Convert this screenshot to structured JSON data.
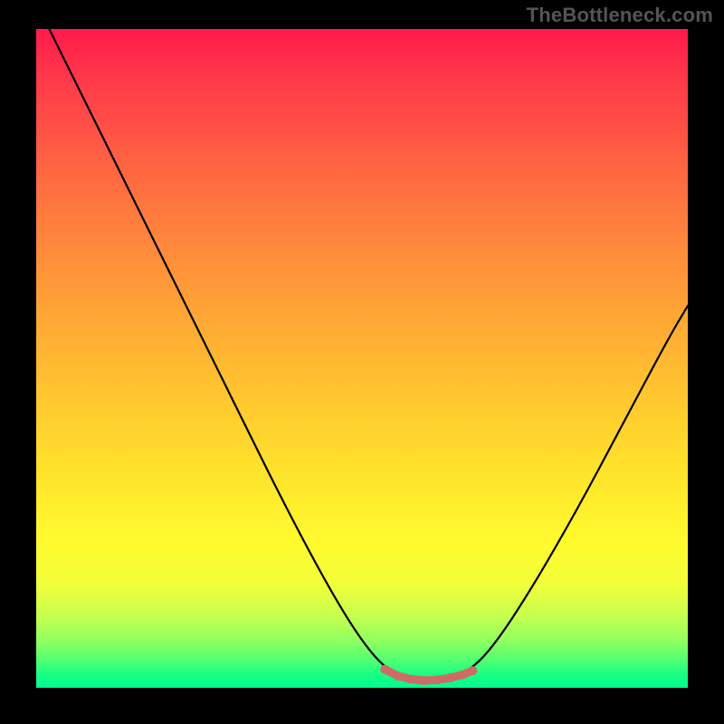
{
  "watermark": "TheBottleneck.com",
  "chart_data": {
    "type": "line",
    "title": "",
    "xlabel": "",
    "ylabel": "",
    "x_range": [
      0,
      100
    ],
    "y_range": [
      0,
      100
    ],
    "grid": false,
    "curve": [
      {
        "x": 2,
        "y": 100
      },
      {
        "x": 8,
        "y": 88
      },
      {
        "x": 15,
        "y": 74
      },
      {
        "x": 22,
        "y": 60
      },
      {
        "x": 30,
        "y": 44
      },
      {
        "x": 38,
        "y": 28
      },
      {
        "x": 45,
        "y": 15
      },
      {
        "x": 50,
        "y": 7
      },
      {
        "x": 54,
        "y": 2.5
      },
      {
        "x": 58,
        "y": 1.2
      },
      {
        "x": 62,
        "y": 1.2
      },
      {
        "x": 66,
        "y": 2.2
      },
      {
        "x": 70,
        "y": 6
      },
      {
        "x": 76,
        "y": 15
      },
      {
        "x": 83,
        "y": 27
      },
      {
        "x": 90,
        "y": 40
      },
      {
        "x": 97,
        "y": 53
      },
      {
        "x": 100,
        "y": 58
      }
    ],
    "highlight_range": {
      "x_start": 53,
      "x_end": 67
    },
    "highlight_points": [
      {
        "x": 53.5,
        "y": 2.8
      },
      {
        "x": 55.5,
        "y": 1.8
      },
      {
        "x": 57.5,
        "y": 1.3
      },
      {
        "x": 59.5,
        "y": 1.1
      },
      {
        "x": 61.5,
        "y": 1.2
      },
      {
        "x": 63.5,
        "y": 1.5
      },
      {
        "x": 65.5,
        "y": 2.0
      },
      {
        "x": 67.0,
        "y": 2.6
      }
    ],
    "colors": {
      "gradient_top": "#ff1a4b",
      "gradient_mid": "#ffd12e",
      "gradient_bottom": "#00ff8e",
      "curve": "#000000",
      "highlight": "#d06a66",
      "frame": "#000000"
    }
  }
}
